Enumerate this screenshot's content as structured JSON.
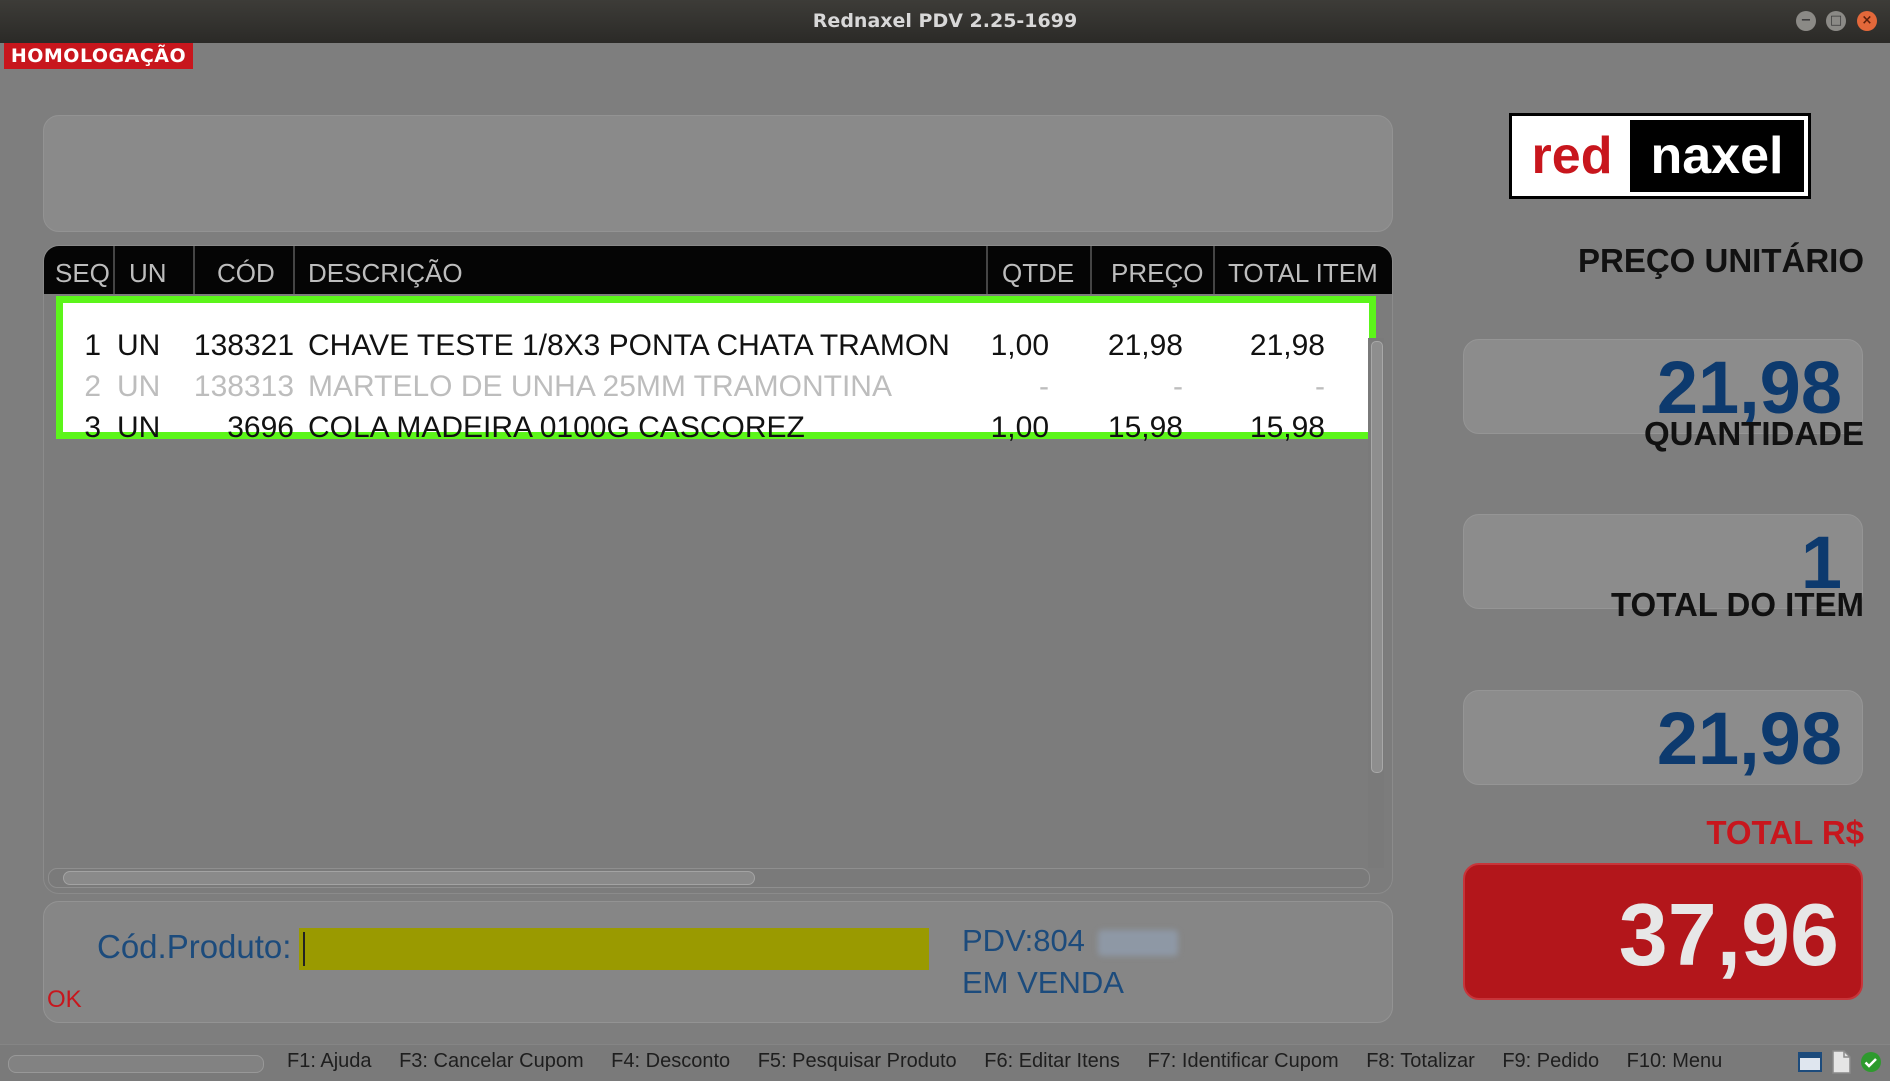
{
  "window": {
    "title": "Rednaxel PDV 2.25-1699",
    "minimize_icon": "−",
    "maximize_icon": "□",
    "close_icon": "×"
  },
  "env_badge": "HOMOLOGAÇÃO",
  "grid": {
    "headers": [
      "SEQ",
      "UN",
      "CÓD",
      "DESCRIÇÃO",
      "QTDE",
      "PREÇO",
      "TOTAL ITEM"
    ],
    "rows": [
      {
        "seq": "1",
        "un": "UN",
        "cod": "138321",
        "desc": "CHAVE TESTE 1/8X3 PONTA CHATA TRAMON",
        "qtde": "1,00",
        "preco": "21,98",
        "total": "21,98",
        "cancelled": false
      },
      {
        "seq": "2",
        "un": "UN",
        "cod": "138313",
        "desc": "MARTELO DE UNHA 25MM TRAMONTINA",
        "qtde": "-",
        "preco": "-",
        "total": "-",
        "cancelled": true
      },
      {
        "seq": "3",
        "un": "UN",
        "cod": "3696",
        "desc": "COLA MADEIRA 0100G CASCOREZ",
        "qtde": "1,00",
        "preco": "15,98",
        "total": "15,98",
        "cancelled": false
      }
    ]
  },
  "input": {
    "label": "Cód.Produto:",
    "value": ""
  },
  "status": {
    "ok": "OK",
    "pdv": "PDV:804",
    "state": "EM VENDA"
  },
  "logo": {
    "left": "red",
    "right": "naxel"
  },
  "right_panel": {
    "preco_label": "PREÇO UNITÁRIO",
    "preco_value": "21,98",
    "qtd_label": "QUANTIDADE",
    "qtd_value": "1",
    "total_item_label": "TOTAL DO ITEM",
    "total_item_value": "21,98",
    "total_label": "TOTAL R$",
    "total_value": "37,96"
  },
  "fkeys": [
    "F1: Ajuda",
    "F3: Cancelar Cupom",
    "F4: Desconto",
    "F5: Pesquisar Produto",
    "F6: Editar Itens",
    "F7: Identificar Cupom",
    "F8: Totalizar",
    "F9: Pedido",
    "F10: Menu"
  ],
  "colors": {
    "accent_red": "#c8161d",
    "accent_blue": "#0d3a6e",
    "highlight_green": "#5cf51a",
    "input_yellow": "#9a9a00"
  }
}
